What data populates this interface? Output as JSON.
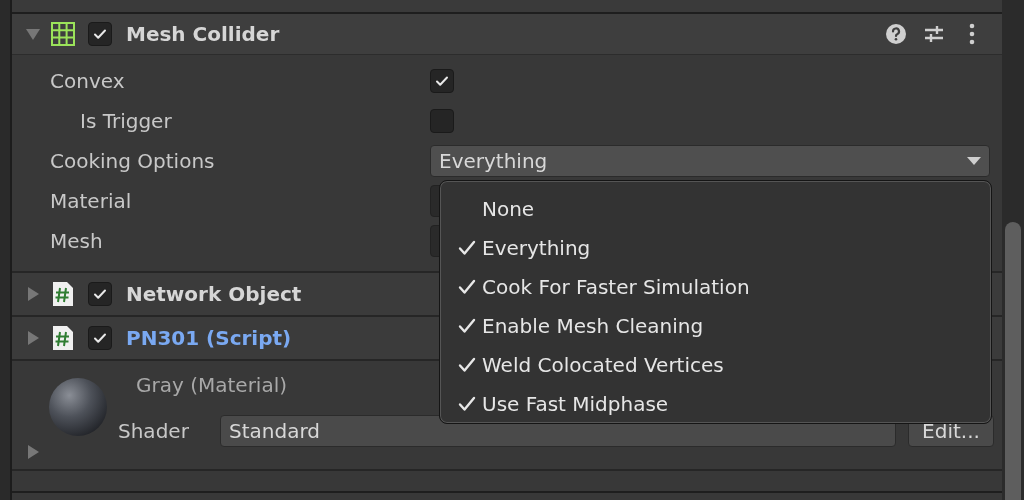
{
  "mesh_collider": {
    "title": "Mesh Collider",
    "expanded": true,
    "enabled": true,
    "properties": [
      {
        "kind": "checkbox",
        "label": "Convex",
        "checked": true,
        "children": [
          {
            "kind": "checkbox",
            "label": "Is Trigger",
            "checked": false
          }
        ]
      },
      {
        "kind": "dropdown",
        "label": "Cooking Options",
        "value": "Everything"
      },
      {
        "kind": "object",
        "label": "Material"
      },
      {
        "kind": "object",
        "label": "Mesh"
      }
    ]
  },
  "dropdown_menu": {
    "items": [
      {
        "label": "None",
        "checked": false
      },
      {
        "label": "Everything",
        "checked": true
      },
      {
        "label": "Cook For Faster Simulation",
        "checked": true
      },
      {
        "label": "Enable Mesh Cleaning",
        "checked": true
      },
      {
        "label": "Weld Colocated Vertices",
        "checked": true
      },
      {
        "label": "Use Fast Midphase",
        "checked": true
      }
    ]
  },
  "components": [
    {
      "title": "Network Object",
      "expanded": false,
      "enabled": true,
      "kind": "plain"
    },
    {
      "title": "PN301 (Script)",
      "expanded": false,
      "enabled": true,
      "kind": "link"
    }
  ],
  "material": {
    "name": "Gray (Material)",
    "expanded": false,
    "shader_label": "Shader",
    "shader": "Standard",
    "edit_button": "Edit..."
  }
}
